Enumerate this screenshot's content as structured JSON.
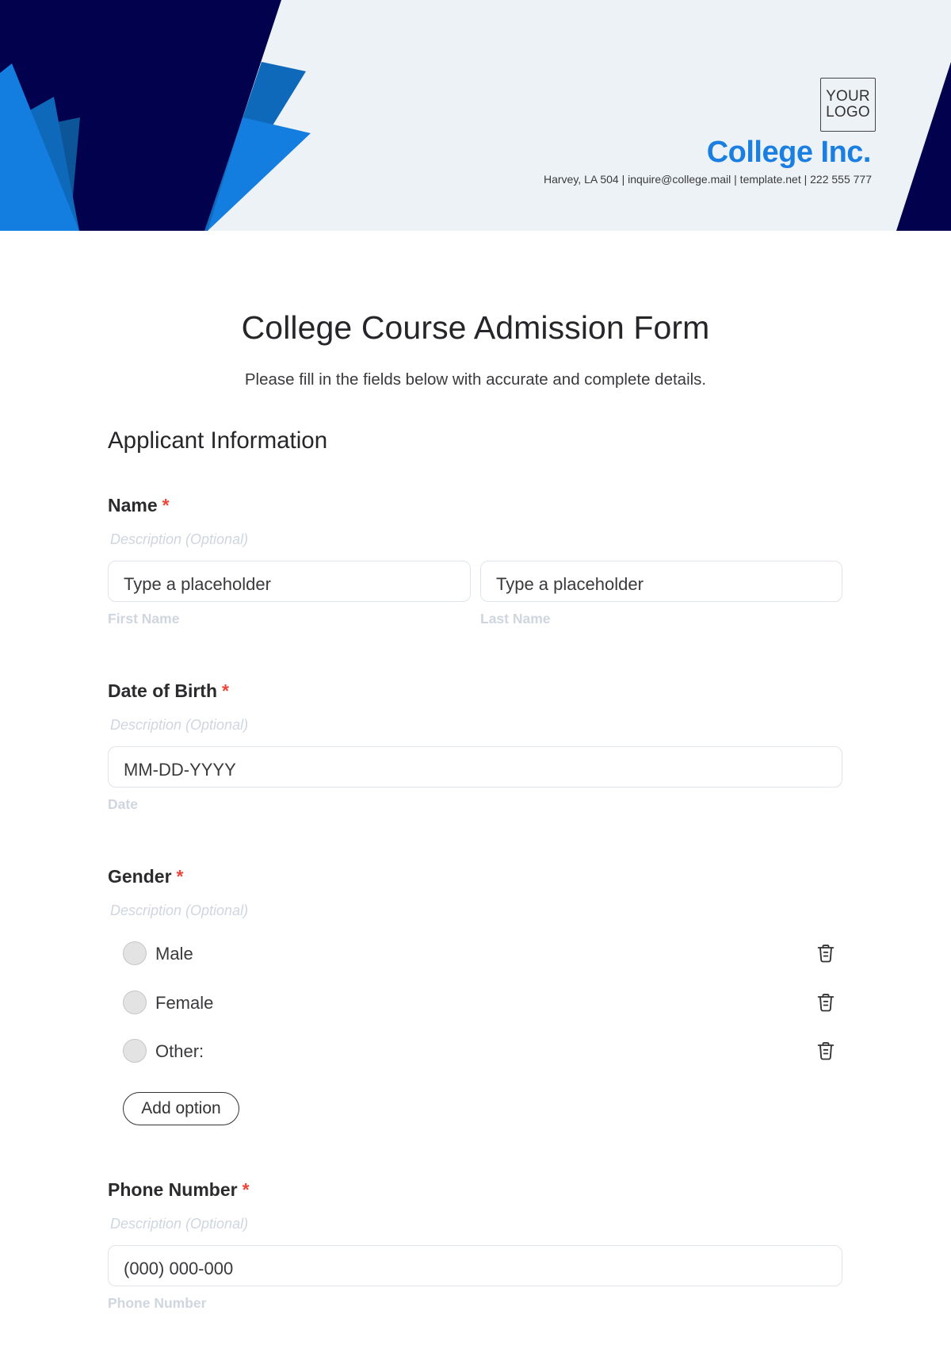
{
  "header": {
    "logo_line1": "YOUR",
    "logo_line2": "LOGO",
    "company_name": "College Inc.",
    "contact": "Harvey, LA 504 | inquire@college.mail | template.net | 222 555 777",
    "colors": {
      "navy": "#01014d",
      "blue_bright": "#137de0",
      "blue_mid": "#0f69ba",
      "blue_dark": "#0d5599",
      "panel": "#edf2f7"
    }
  },
  "form": {
    "title": "College Course Admission Form",
    "subtitle": "Please fill in the fields below with accurate and complete details.",
    "section_title": "Applicant Information",
    "required_mark": "*",
    "fields": {
      "name": {
        "label": "Name",
        "description": "Description (Optional)",
        "first_placeholder": "Type a placeholder",
        "first_sublabel": "First Name",
        "last_placeholder": "Type a placeholder",
        "last_sublabel": "Last Name"
      },
      "dob": {
        "label": "Date of Birth",
        "description": "Description (Optional)",
        "placeholder": "MM-DD-YYYY",
        "sublabel": "Date"
      },
      "gender": {
        "label": "Gender",
        "description": "Description (Optional)",
        "options": [
          {
            "label": "Male",
            "icon": "trash-icon"
          },
          {
            "label": "Female",
            "icon": "trash-icon"
          },
          {
            "label": "Other:",
            "icon": "trash-icon"
          }
        ],
        "add_option_label": "Add option"
      },
      "phone": {
        "label": "Phone Number",
        "description": "Description (Optional)",
        "placeholder": "(000) 000-000",
        "sublabel": "Phone Number"
      }
    },
    "accent_required": "#f0463a"
  }
}
